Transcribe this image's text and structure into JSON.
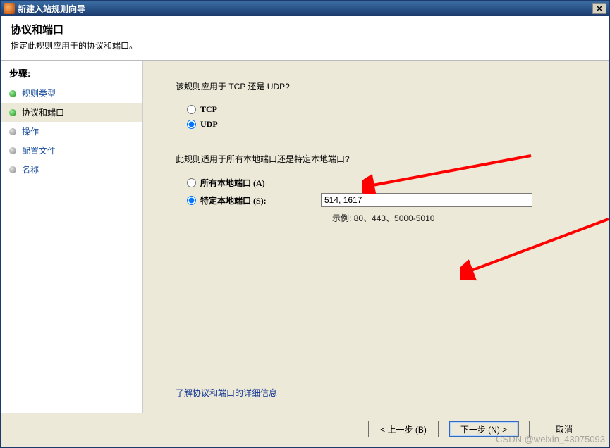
{
  "window": {
    "title": "新建入站规则向导"
  },
  "header": {
    "title": "协议和端口",
    "subtitle": "指定此规则应用于的协议和端口。"
  },
  "sidebar": {
    "label": "步骤:",
    "items": [
      {
        "label": "规则类型"
      },
      {
        "label": "协议和端口"
      },
      {
        "label": "操作"
      },
      {
        "label": "配置文件"
      },
      {
        "label": "名称"
      }
    ]
  },
  "main": {
    "q1": "该规则应用于 TCP 还是 UDP?",
    "tcp": "TCP",
    "udp": "UDP",
    "q2": "此规则适用于所有本地端口还是特定本地端口?",
    "allports": "所有本地端口 (A)",
    "specports": "特定本地端口 (S):",
    "port_value": "514, 1617",
    "example": "示例: 80、443、5000-5010",
    "learn_more": "了解协议和端口的详细信息"
  },
  "footer": {
    "back": "< 上一步 (B)",
    "next": "下一步 (N) >",
    "cancel": "取消"
  },
  "watermark": "CSDN @weixin_43075093"
}
